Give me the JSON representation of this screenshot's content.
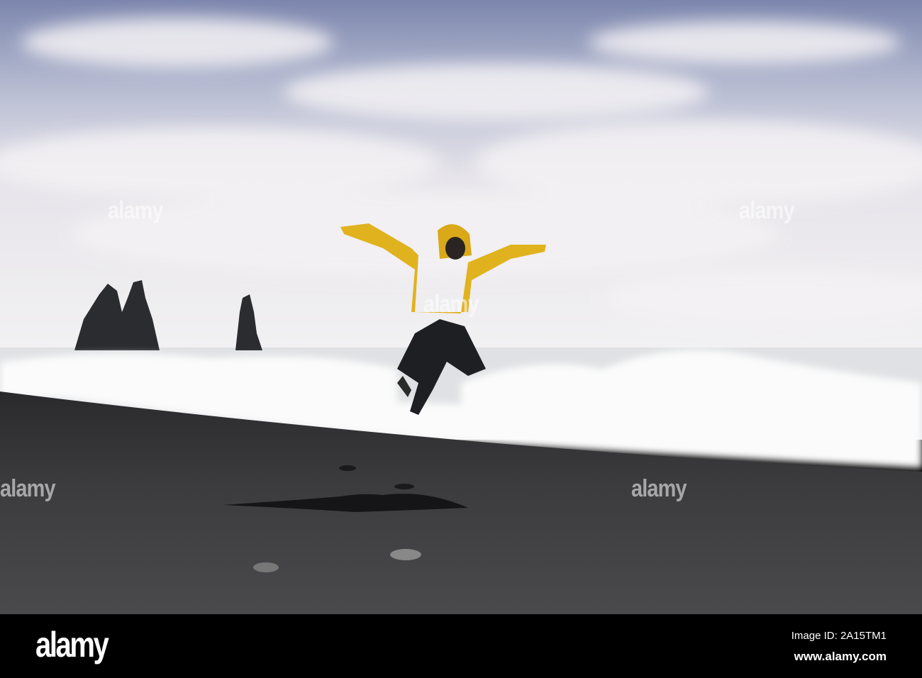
{
  "watermark": "alamy",
  "footer": {
    "logo": "alamy",
    "image_id": "Image ID: 2A15TM1",
    "website": "www.alamy.com"
  },
  "colors": {
    "jacket": "#e0b21e",
    "sand": "#3e3e40",
    "sky": "#8f9bbd"
  }
}
